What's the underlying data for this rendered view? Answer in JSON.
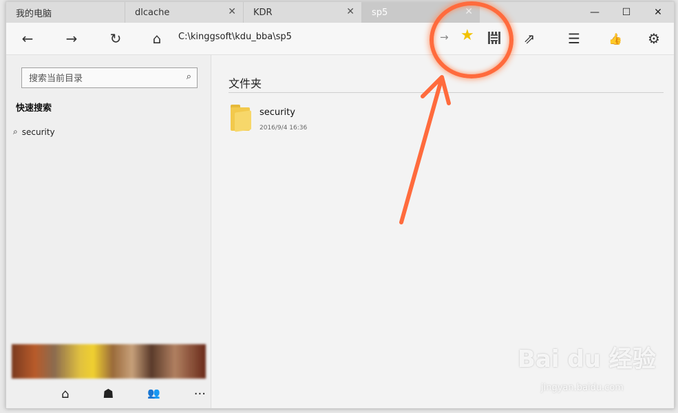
{
  "tabs": [
    {
      "label": "我的电脑",
      "closable": false
    },
    {
      "label": "dlcache",
      "closable": true
    },
    {
      "label": "KDR",
      "closable": true
    },
    {
      "label": "sp5",
      "closable": true,
      "active": true
    }
  ],
  "window_controls": {
    "minimize": "—",
    "maximize": "☐",
    "close": "✕"
  },
  "toolbar": {
    "back_icon": "←",
    "forward_icon": "→",
    "refresh_icon": "↻",
    "home_icon": "⌂",
    "address": "C:\\kinggsoft\\kdu_bba\\sp5",
    "go_icon": "→",
    "favorite_icon": "★",
    "share_icon": "⇗",
    "checklist_icon": "☰",
    "like_icon": "👍",
    "settings_icon": "⚙"
  },
  "sidebar": {
    "search_placeholder": "搜索当前目录",
    "search_icon": "⌕",
    "quick_search_title": "快速搜索",
    "quick_items": [
      {
        "label": "security",
        "icon": "⌕"
      }
    ],
    "bottom_nav": [
      {
        "icon": "⌂",
        "name": "home"
      },
      {
        "icon": "☗",
        "name": "robot"
      },
      {
        "icon": "👥",
        "name": "users"
      },
      {
        "icon": "···",
        "name": "more"
      }
    ]
  },
  "main": {
    "section_title": "文件夹",
    "folders": [
      {
        "name": "security",
        "date": "2016/9/4 16:36"
      }
    ]
  },
  "watermark": {
    "text": "Bai du 经验",
    "sub": "jingyan.baidu.com"
  },
  "colors": {
    "annotation": "#ff6b3d",
    "star": "#f2c200",
    "folder": "#f2c94c"
  }
}
